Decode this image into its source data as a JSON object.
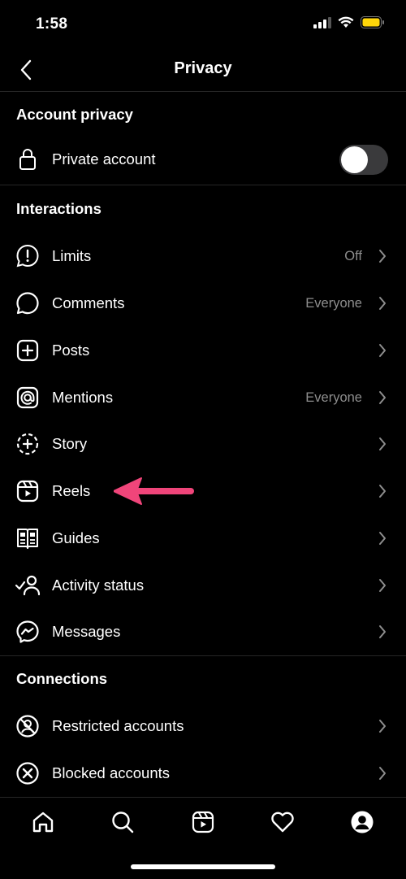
{
  "status_bar": {
    "time": "1:58"
  },
  "header": {
    "title": "Privacy"
  },
  "sections": {
    "account_privacy": "Account privacy",
    "interactions": "Interactions",
    "connections": "Connections"
  },
  "private_account": {
    "label": "Private account",
    "enabled": false
  },
  "interactions": [
    {
      "label": "Limits",
      "value": "Off",
      "icon": "alert-circle-icon"
    },
    {
      "label": "Comments",
      "value": "Everyone",
      "icon": "comment-icon"
    },
    {
      "label": "Posts",
      "value": "",
      "icon": "plus-square-icon"
    },
    {
      "label": "Mentions",
      "value": "Everyone",
      "icon": "at-sign-icon"
    },
    {
      "label": "Story",
      "value": "",
      "icon": "story-add-icon"
    },
    {
      "label": "Reels",
      "value": "",
      "icon": "reels-icon"
    },
    {
      "label": "Guides",
      "value": "",
      "icon": "guides-icon"
    },
    {
      "label": "Activity status",
      "value": "",
      "icon": "activity-status-icon"
    },
    {
      "label": "Messages",
      "value": "",
      "icon": "messenger-icon"
    }
  ],
  "connections": [
    {
      "label": "Restricted accounts",
      "icon": "restricted-icon"
    },
    {
      "label": "Blocked accounts",
      "icon": "blocked-icon"
    }
  ],
  "annotation_color": "#f0457a",
  "tab_bar": [
    "home-icon",
    "search-icon",
    "reels-tab-icon",
    "heart-icon",
    "profile-icon"
  ]
}
